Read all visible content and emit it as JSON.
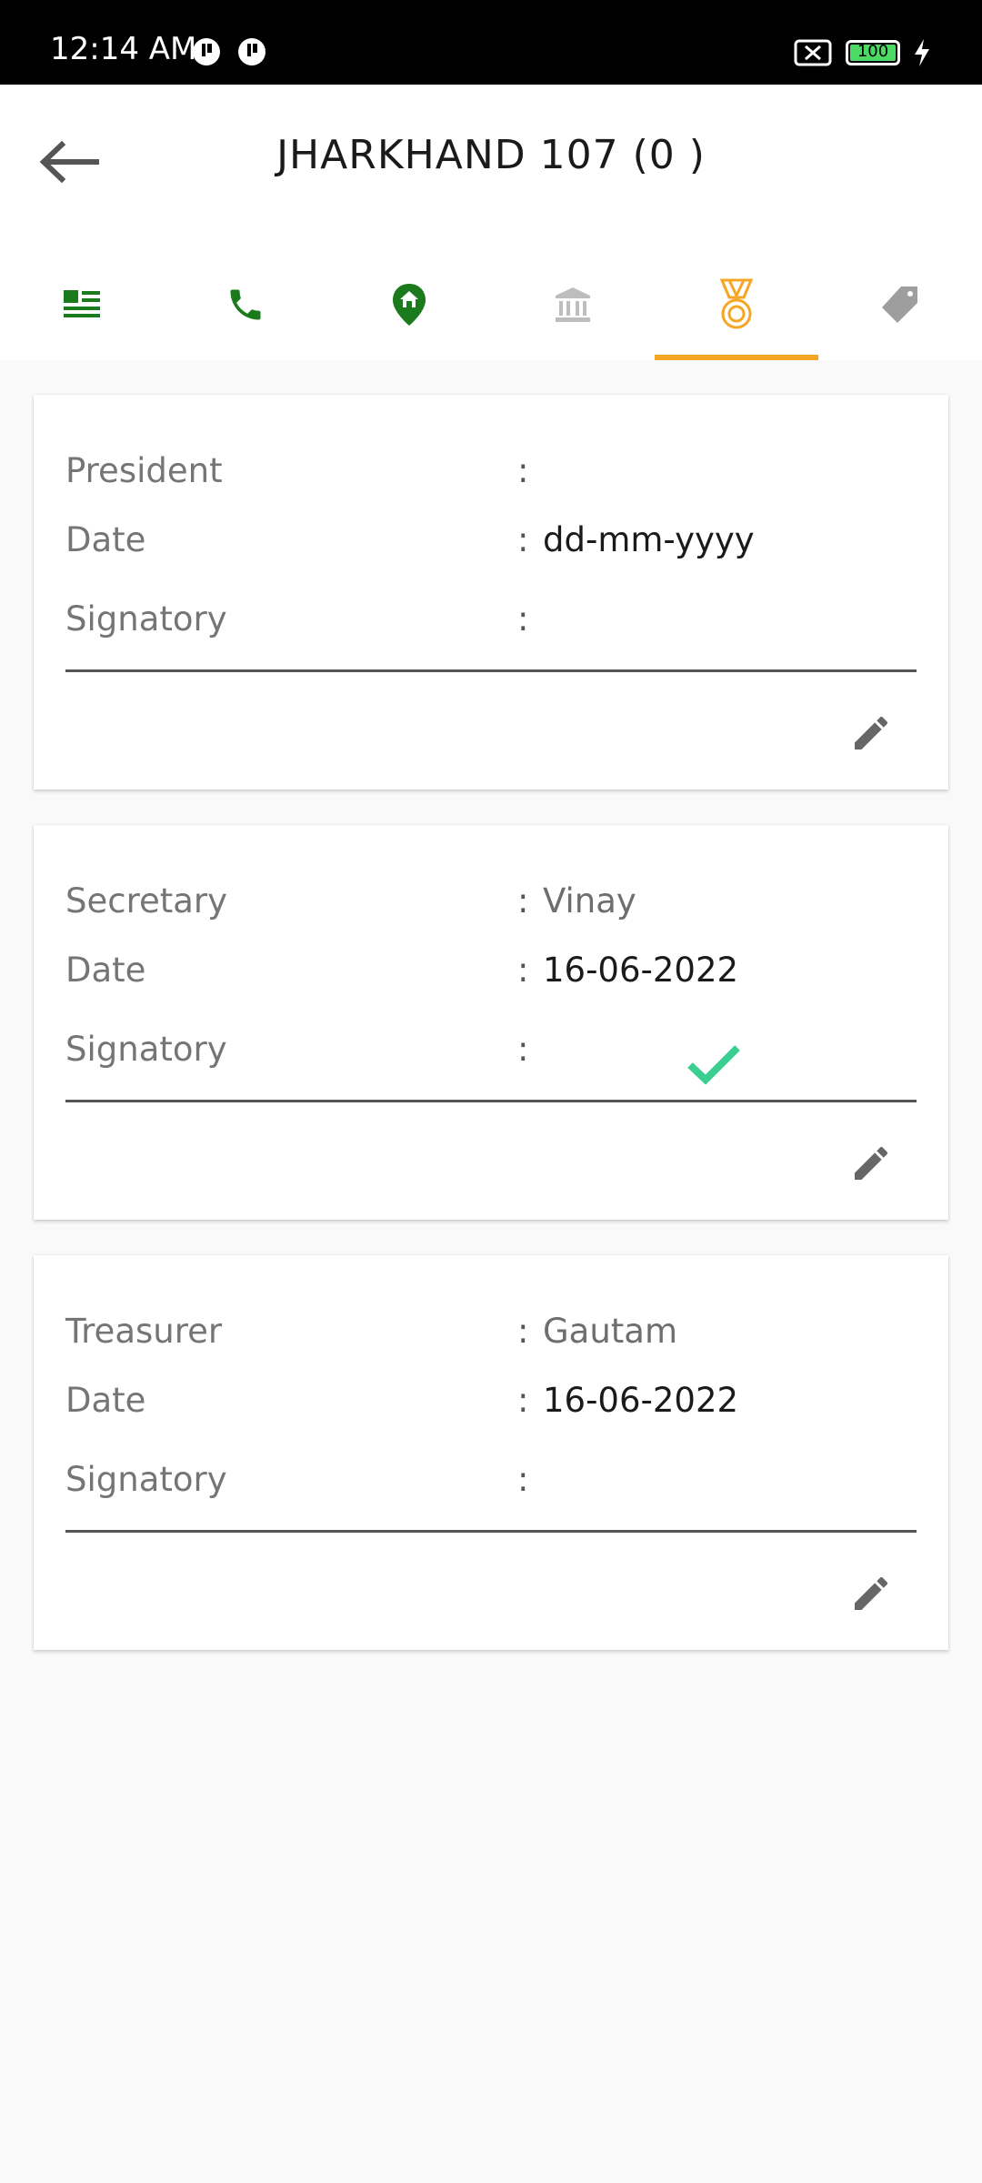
{
  "status_bar": {
    "time": "12:14 AM",
    "battery": "100"
  },
  "header": {
    "title": "JHARKHAND 107 (0 )"
  },
  "tabs": [
    {
      "icon": "list-icon",
      "active": false
    },
    {
      "icon": "phone-icon",
      "active": false
    },
    {
      "icon": "location-home-icon",
      "active": false
    },
    {
      "icon": "bank-icon",
      "active": false
    },
    {
      "icon": "medal-icon",
      "active": true
    },
    {
      "icon": "tag-icon",
      "active": false
    }
  ],
  "colors": {
    "accent": "#f5a623",
    "green": "#1b7a1b",
    "check": "#3ccf91",
    "grey_icon": "#9e9e9e"
  },
  "cards": [
    {
      "role_label": "President",
      "role_value": "",
      "date_label": "Date",
      "date_value": "dd-mm-yyyy",
      "signatory_label": "Signatory",
      "signed": false
    },
    {
      "role_label": "Secretary",
      "role_value": "Vinay",
      "date_label": "Date",
      "date_value": "16-06-2022",
      "signatory_label": "Signatory",
      "signed": true
    },
    {
      "role_label": "Treasurer",
      "role_value": "Gautam",
      "date_label": "Date",
      "date_value": "16-06-2022",
      "signatory_label": "Signatory",
      "signed": false
    }
  ],
  "colon": ":"
}
